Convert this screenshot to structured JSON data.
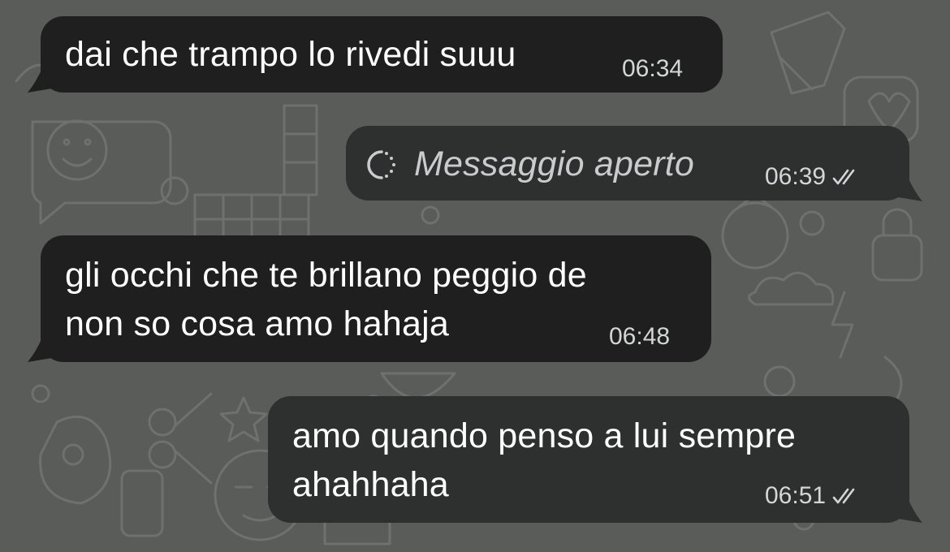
{
  "chat": {
    "wallpaper": "whatsapp-doodle-pattern",
    "colors": {
      "wallpaper": "#5a5c59",
      "incoming_bubble": "#1f1f1f",
      "outgoing_bubble": "#2e3030",
      "text": "#ffffff",
      "meta_text": "#d3d6d6"
    },
    "messages": [
      {
        "direction": "incoming",
        "lines": [
          "dai che trampo lo rivedi suuu"
        ],
        "time": "06:34"
      },
      {
        "direction": "outgoing",
        "type": "view-once-opened",
        "icon": "view-once-icon",
        "text": "Messaggio aperto",
        "time": "06:39",
        "status_icon": "double-check-icon"
      },
      {
        "direction": "incoming",
        "lines": [
          "gli occhi che te brillano peggio de",
          "non so cosa amo hahaja"
        ],
        "time": "06:48"
      },
      {
        "direction": "outgoing",
        "lines": [
          "amo quando penso a lui sempre",
          "ahahhaha"
        ],
        "time": "06:51",
        "status_icon": "double-check-icon"
      }
    ]
  }
}
